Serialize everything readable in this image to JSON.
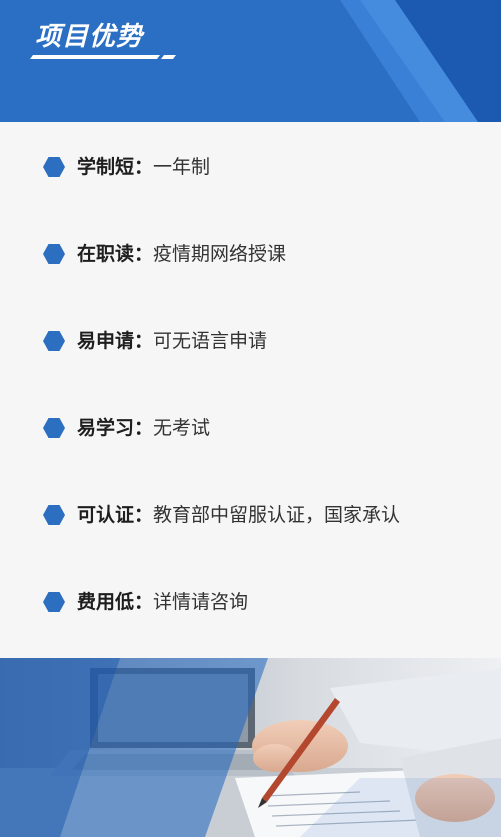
{
  "header": {
    "title": "项目优势",
    "colors": {
      "primary": "#2a6fc4",
      "dark": "#1a57a8",
      "light": "#4d8ee0"
    }
  },
  "advantages": [
    {
      "label": "学制短",
      "separator": "：",
      "value": "一年制"
    },
    {
      "label": "在职读",
      "separator": "：",
      "value": "疫情期网络授课"
    },
    {
      "label": "易申请",
      "separator": "：",
      "value": "可无语言申请"
    },
    {
      "label": "易学习",
      "separator": "：",
      "value": "无考试"
    },
    {
      "label": "可认证",
      "separator": "：",
      "value": "教育部中留服认证，国家承认"
    },
    {
      "label": "费用低",
      "separator": "：",
      "value": "详情请咨询"
    }
  ],
  "bullet_icon": "hexagon-bullet-icon",
  "photo": {
    "subject": "business-hands-pen-documents-laptop-photo"
  }
}
